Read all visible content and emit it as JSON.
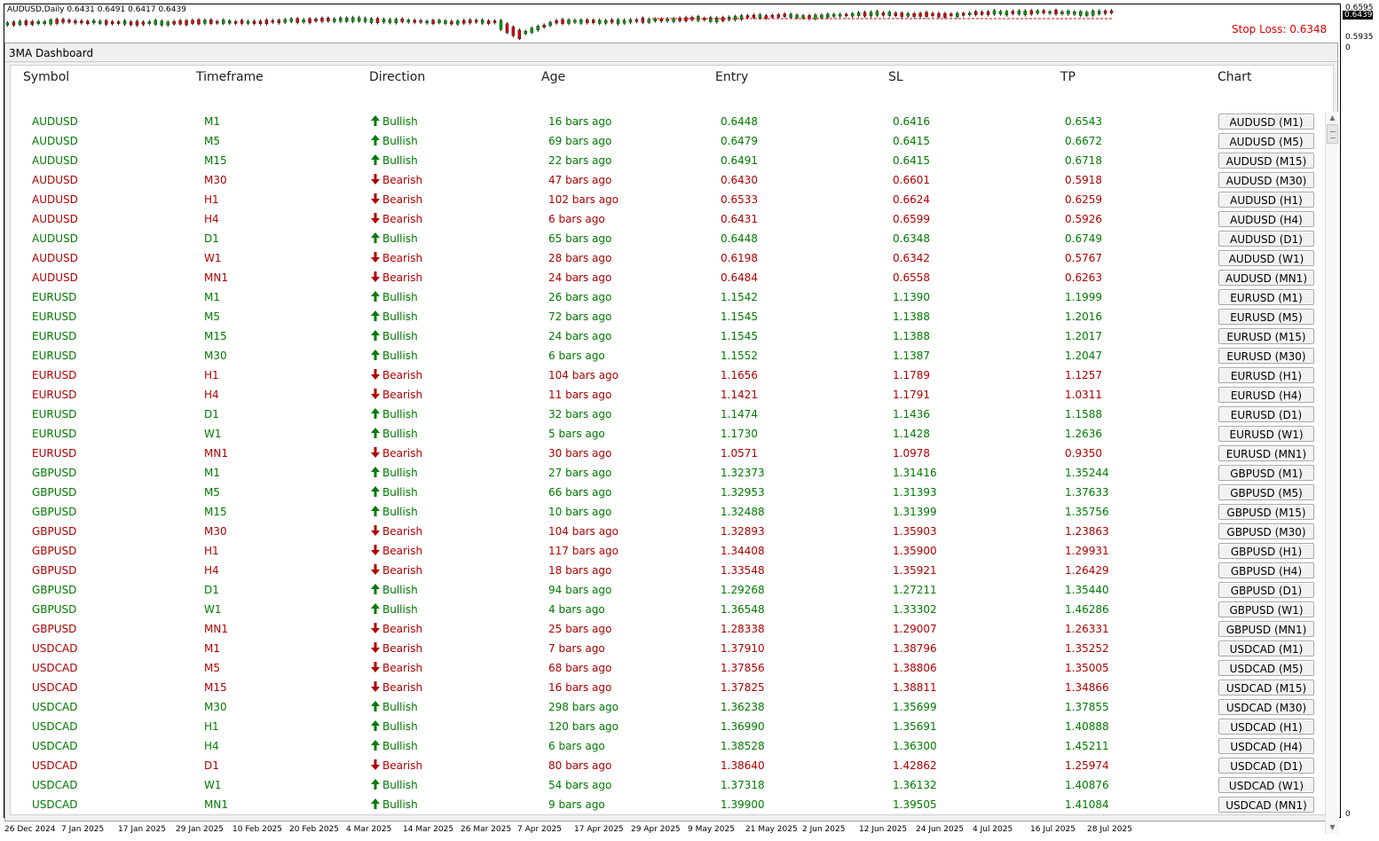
{
  "chart": {
    "title": "AUDUSD,Daily  0.6431 0.6491 0.6417 0.6439",
    "stop_loss_label": "Stop Loss: 0.6348",
    "price_ticks": [
      "0.6595",
      "0.5935",
      "0"
    ],
    "current_price": "0.6439",
    "bottom_tick": "0",
    "dates": [
      "26 Dec 2024",
      "7 Jan 2025",
      "17 Jan 2025",
      "29 Jan 2025",
      "10 Feb 2025",
      "20 Feb 2025",
      "4 Mar 2025",
      "14 Mar 2025",
      "26 Mar 2025",
      "7 Apr 2025",
      "17 Apr 2025",
      "29 Apr 2025",
      "9 May 2025",
      "21 May 2025",
      "2 Jun 2025",
      "12 Jun 2025",
      "24 Jun 2025",
      "4 Jul 2025",
      "16 Jul 2025",
      "28 Jul 2025"
    ],
    "colors": {
      "bull": "#00a000",
      "bear": "#e00000",
      "stop_loss": "#e00000"
    }
  },
  "dashboard": {
    "title": "3MA Dashboard",
    "headers": [
      "Symbol",
      "Timeframe",
      "Direction",
      "Age",
      "Entry",
      "SL",
      "TP",
      "Chart"
    ],
    "colors": {
      "bullish": "#007a00",
      "bearish": "#b00000"
    },
    "rows": [
      {
        "symbol": "AUDUSD",
        "tf": "M1",
        "dir": "Bullish",
        "age": "16 bars ago",
        "entry": "0.6448",
        "sl": "0.6416",
        "tp": "0.6543",
        "btn": "AUDUSD (M1)"
      },
      {
        "symbol": "AUDUSD",
        "tf": "M5",
        "dir": "Bullish",
        "age": "69 bars ago",
        "entry": "0.6479",
        "sl": "0.6415",
        "tp": "0.6672",
        "btn": "AUDUSD (M5)"
      },
      {
        "symbol": "AUDUSD",
        "tf": "M15",
        "dir": "Bullish",
        "age": "22 bars ago",
        "entry": "0.6491",
        "sl": "0.6415",
        "tp": "0.6718",
        "btn": "AUDUSD (M15)"
      },
      {
        "symbol": "AUDUSD",
        "tf": "M30",
        "dir": "Bearish",
        "age": "47 bars ago",
        "entry": "0.6430",
        "sl": "0.6601",
        "tp": "0.5918",
        "btn": "AUDUSD (M30)"
      },
      {
        "symbol": "AUDUSD",
        "tf": "H1",
        "dir": "Bearish",
        "age": "102 bars ago",
        "entry": "0.6533",
        "sl": "0.6624",
        "tp": "0.6259",
        "btn": "AUDUSD (H1)"
      },
      {
        "symbol": "AUDUSD",
        "tf": "H4",
        "dir": "Bearish",
        "age": "6 bars ago",
        "entry": "0.6431",
        "sl": "0.6599",
        "tp": "0.5926",
        "btn": "AUDUSD (H4)"
      },
      {
        "symbol": "AUDUSD",
        "tf": "D1",
        "dir": "Bullish",
        "age": "65 bars ago",
        "entry": "0.6448",
        "sl": "0.6348",
        "tp": "0.6749",
        "btn": "AUDUSD (D1)"
      },
      {
        "symbol": "AUDUSD",
        "tf": "W1",
        "dir": "Bearish",
        "age": "28 bars ago",
        "entry": "0.6198",
        "sl": "0.6342",
        "tp": "0.5767",
        "btn": "AUDUSD (W1)"
      },
      {
        "symbol": "AUDUSD",
        "tf": "MN1",
        "dir": "Bearish",
        "age": "24 bars ago",
        "entry": "0.6484",
        "sl": "0.6558",
        "tp": "0.6263",
        "btn": "AUDUSD (MN1)"
      },
      {
        "symbol": "EURUSD",
        "tf": "M1",
        "dir": "Bullish",
        "age": "26 bars ago",
        "entry": "1.1542",
        "sl": "1.1390",
        "tp": "1.1999",
        "btn": "EURUSD (M1)"
      },
      {
        "symbol": "EURUSD",
        "tf": "M5",
        "dir": "Bullish",
        "age": "72 bars ago",
        "entry": "1.1545",
        "sl": "1.1388",
        "tp": "1.2016",
        "btn": "EURUSD (M5)"
      },
      {
        "symbol": "EURUSD",
        "tf": "M15",
        "dir": "Bullish",
        "age": "24 bars ago",
        "entry": "1.1545",
        "sl": "1.1388",
        "tp": "1.2017",
        "btn": "EURUSD (M15)"
      },
      {
        "symbol": "EURUSD",
        "tf": "M30",
        "dir": "Bullish",
        "age": "6 bars ago",
        "entry": "1.1552",
        "sl": "1.1387",
        "tp": "1.2047",
        "btn": "EURUSD (M30)"
      },
      {
        "symbol": "EURUSD",
        "tf": "H1",
        "dir": "Bearish",
        "age": "104 bars ago",
        "entry": "1.1656",
        "sl": "1.1789",
        "tp": "1.1257",
        "btn": "EURUSD (H1)"
      },
      {
        "symbol": "EURUSD",
        "tf": "H4",
        "dir": "Bearish",
        "age": "11 bars ago",
        "entry": "1.1421",
        "sl": "1.1791",
        "tp": "1.0311",
        "btn": "EURUSD (H4)"
      },
      {
        "symbol": "EURUSD",
        "tf": "D1",
        "dir": "Bullish",
        "age": "32 bars ago",
        "entry": "1.1474",
        "sl": "1.1436",
        "tp": "1.1588",
        "btn": "EURUSD (D1)"
      },
      {
        "symbol": "EURUSD",
        "tf": "W1",
        "dir": "Bullish",
        "age": "5 bars ago",
        "entry": "1.1730",
        "sl": "1.1428",
        "tp": "1.2636",
        "btn": "EURUSD (W1)"
      },
      {
        "symbol": "EURUSD",
        "tf": "MN1",
        "dir": "Bearish",
        "age": "30 bars ago",
        "entry": "1.0571",
        "sl": "1.0978",
        "tp": "0.9350",
        "btn": "EURUSD (MN1)"
      },
      {
        "symbol": "GBPUSD",
        "tf": "M1",
        "dir": "Bullish",
        "age": "27 bars ago",
        "entry": "1.32373",
        "sl": "1.31416",
        "tp": "1.35244",
        "btn": "GBPUSD (M1)"
      },
      {
        "symbol": "GBPUSD",
        "tf": "M5",
        "dir": "Bullish",
        "age": "66 bars ago",
        "entry": "1.32953",
        "sl": "1.31393",
        "tp": "1.37633",
        "btn": "GBPUSD (M5)"
      },
      {
        "symbol": "GBPUSD",
        "tf": "M15",
        "dir": "Bullish",
        "age": "10 bars ago",
        "entry": "1.32488",
        "sl": "1.31399",
        "tp": "1.35756",
        "btn": "GBPUSD (M15)"
      },
      {
        "symbol": "GBPUSD",
        "tf": "M30",
        "dir": "Bearish",
        "age": "104 bars ago",
        "entry": "1.32893",
        "sl": "1.35903",
        "tp": "1.23863",
        "btn": "GBPUSD (M30)"
      },
      {
        "symbol": "GBPUSD",
        "tf": "H1",
        "dir": "Bearish",
        "age": "117 bars ago",
        "entry": "1.34408",
        "sl": "1.35900",
        "tp": "1.29931",
        "btn": "GBPUSD (H1)"
      },
      {
        "symbol": "GBPUSD",
        "tf": "H4",
        "dir": "Bearish",
        "age": "18 bars ago",
        "entry": "1.33548",
        "sl": "1.35921",
        "tp": "1.26429",
        "btn": "GBPUSD (H4)"
      },
      {
        "symbol": "GBPUSD",
        "tf": "D1",
        "dir": "Bullish",
        "age": "94 bars ago",
        "entry": "1.29268",
        "sl": "1.27211",
        "tp": "1.35440",
        "btn": "GBPUSD (D1)"
      },
      {
        "symbol": "GBPUSD",
        "tf": "W1",
        "dir": "Bullish",
        "age": "4 bars ago",
        "entry": "1.36548",
        "sl": "1.33302",
        "tp": "1.46286",
        "btn": "GBPUSD (W1)"
      },
      {
        "symbol": "GBPUSD",
        "tf": "MN1",
        "dir": "Bearish",
        "age": "25 bars ago",
        "entry": "1.28338",
        "sl": "1.29007",
        "tp": "1.26331",
        "btn": "GBPUSD (MN1)"
      },
      {
        "symbol": "USDCAD",
        "tf": "M1",
        "dir": "Bearish",
        "age": "7 bars ago",
        "entry": "1.37910",
        "sl": "1.38796",
        "tp": "1.35252",
        "btn": "USDCAD (M1)"
      },
      {
        "symbol": "USDCAD",
        "tf": "M5",
        "dir": "Bearish",
        "age": "68 bars ago",
        "entry": "1.37856",
        "sl": "1.38806",
        "tp": "1.35005",
        "btn": "USDCAD (M5)"
      },
      {
        "symbol": "USDCAD",
        "tf": "M15",
        "dir": "Bearish",
        "age": "16 bars ago",
        "entry": "1.37825",
        "sl": "1.38811",
        "tp": "1.34866",
        "btn": "USDCAD (M15)"
      },
      {
        "symbol": "USDCAD",
        "tf": "M30",
        "dir": "Bullish",
        "age": "298 bars ago",
        "entry": "1.36238",
        "sl": "1.35699",
        "tp": "1.37855",
        "btn": "USDCAD (M30)"
      },
      {
        "symbol": "USDCAD",
        "tf": "H1",
        "dir": "Bullish",
        "age": "120 bars ago",
        "entry": "1.36990",
        "sl": "1.35691",
        "tp": "1.40888",
        "btn": "USDCAD (H1)"
      },
      {
        "symbol": "USDCAD",
        "tf": "H4",
        "dir": "Bullish",
        "age": "6 bars ago",
        "entry": "1.38528",
        "sl": "1.36300",
        "tp": "1.45211",
        "btn": "USDCAD (H4)"
      },
      {
        "symbol": "USDCAD",
        "tf": "D1",
        "dir": "Bearish",
        "age": "80 bars ago",
        "entry": "1.38640",
        "sl": "1.42862",
        "tp": "1.25974",
        "btn": "USDCAD (D1)"
      },
      {
        "symbol": "USDCAD",
        "tf": "W1",
        "dir": "Bullish",
        "age": "54 bars ago",
        "entry": "1.37318",
        "sl": "1.36132",
        "tp": "1.40876",
        "btn": "USDCAD (W1)"
      },
      {
        "symbol": "USDCAD",
        "tf": "MN1",
        "dir": "Bullish",
        "age": "9 bars ago",
        "entry": "1.39900",
        "sl": "1.39505",
        "tp": "1.41084",
        "btn": "USDCAD (MN1)"
      }
    ]
  }
}
